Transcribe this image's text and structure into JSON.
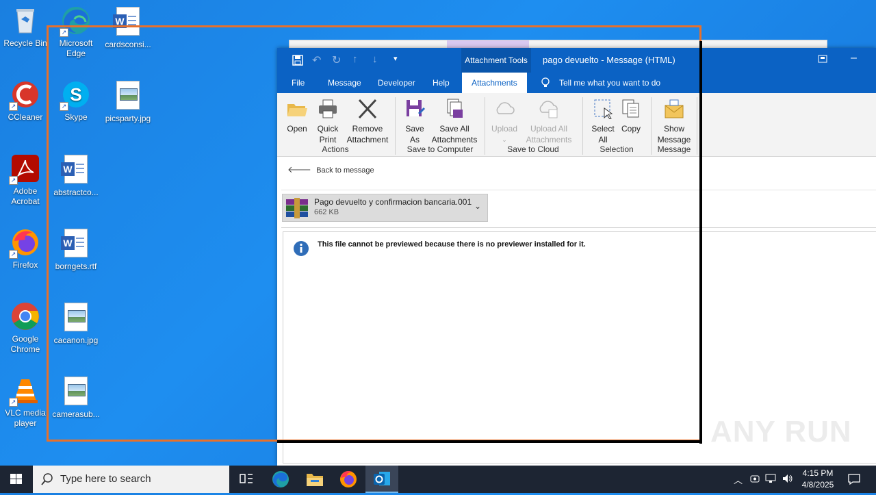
{
  "desktop": {
    "icons": [
      {
        "label": "Recycle Bin"
      },
      {
        "label": "Microsoft Edge"
      },
      {
        "label": "cardsconsi..."
      },
      {
        "label": "CCleaner"
      },
      {
        "label": "Skype"
      },
      {
        "label": "picsparty.jpg"
      },
      {
        "label": "Adobe Acrobat"
      },
      {
        "label": "abstractco..."
      },
      {
        "label": "Firefox"
      },
      {
        "label": "borngets.rtf"
      },
      {
        "label": "Google Chrome"
      },
      {
        "label": "cacanon.jpg"
      },
      {
        "label": "VLC media player"
      },
      {
        "label": "camerasub..."
      }
    ]
  },
  "window": {
    "context_tab": "Attachment Tools",
    "title": "pago devuelto  -  Message (HTML)",
    "tabs": [
      "File",
      "Message",
      "Developer",
      "Help",
      "Attachments"
    ],
    "active_tab": "Attachments",
    "tell_me": "Tell me what you want to do"
  },
  "ribbon": {
    "open": "Open",
    "quick_print_1": "Quick",
    "quick_print_2": "Print",
    "remove_1": "Remove",
    "remove_2": "Attachment",
    "actions_group": "Actions",
    "save_as_1": "Save",
    "save_as_2": "As",
    "save_all_1": "Save All",
    "save_all_2": "Attachments",
    "save_computer_group": "Save to Computer",
    "upload": "Upload",
    "upload_all_1": "Upload All",
    "upload_all_2": "Attachments",
    "save_cloud_group": "Save to Cloud",
    "select_all_1": "Select",
    "select_all_2": "All",
    "copy": "Copy",
    "selection_group": "Selection",
    "show_msg_1": "Show",
    "show_msg_2": "Message",
    "message_group": "Message"
  },
  "content": {
    "back": "Back to message",
    "attachment_name": "Pago devuelto y confirmacion bancaria.001",
    "attachment_size": "662 KB",
    "notice": "This file cannot be previewed because there is no previewer installed for it."
  },
  "taskbar": {
    "search_placeholder": "Type here to search",
    "time": "4:15 PM",
    "date": "4/8/2025"
  },
  "watermark": "ANY RUN",
  "colors": {
    "accent": "#0b62c4",
    "desktop": "#1a7fe0",
    "taskbar": "#1d2533",
    "highlight_orange": "#e8702a"
  }
}
